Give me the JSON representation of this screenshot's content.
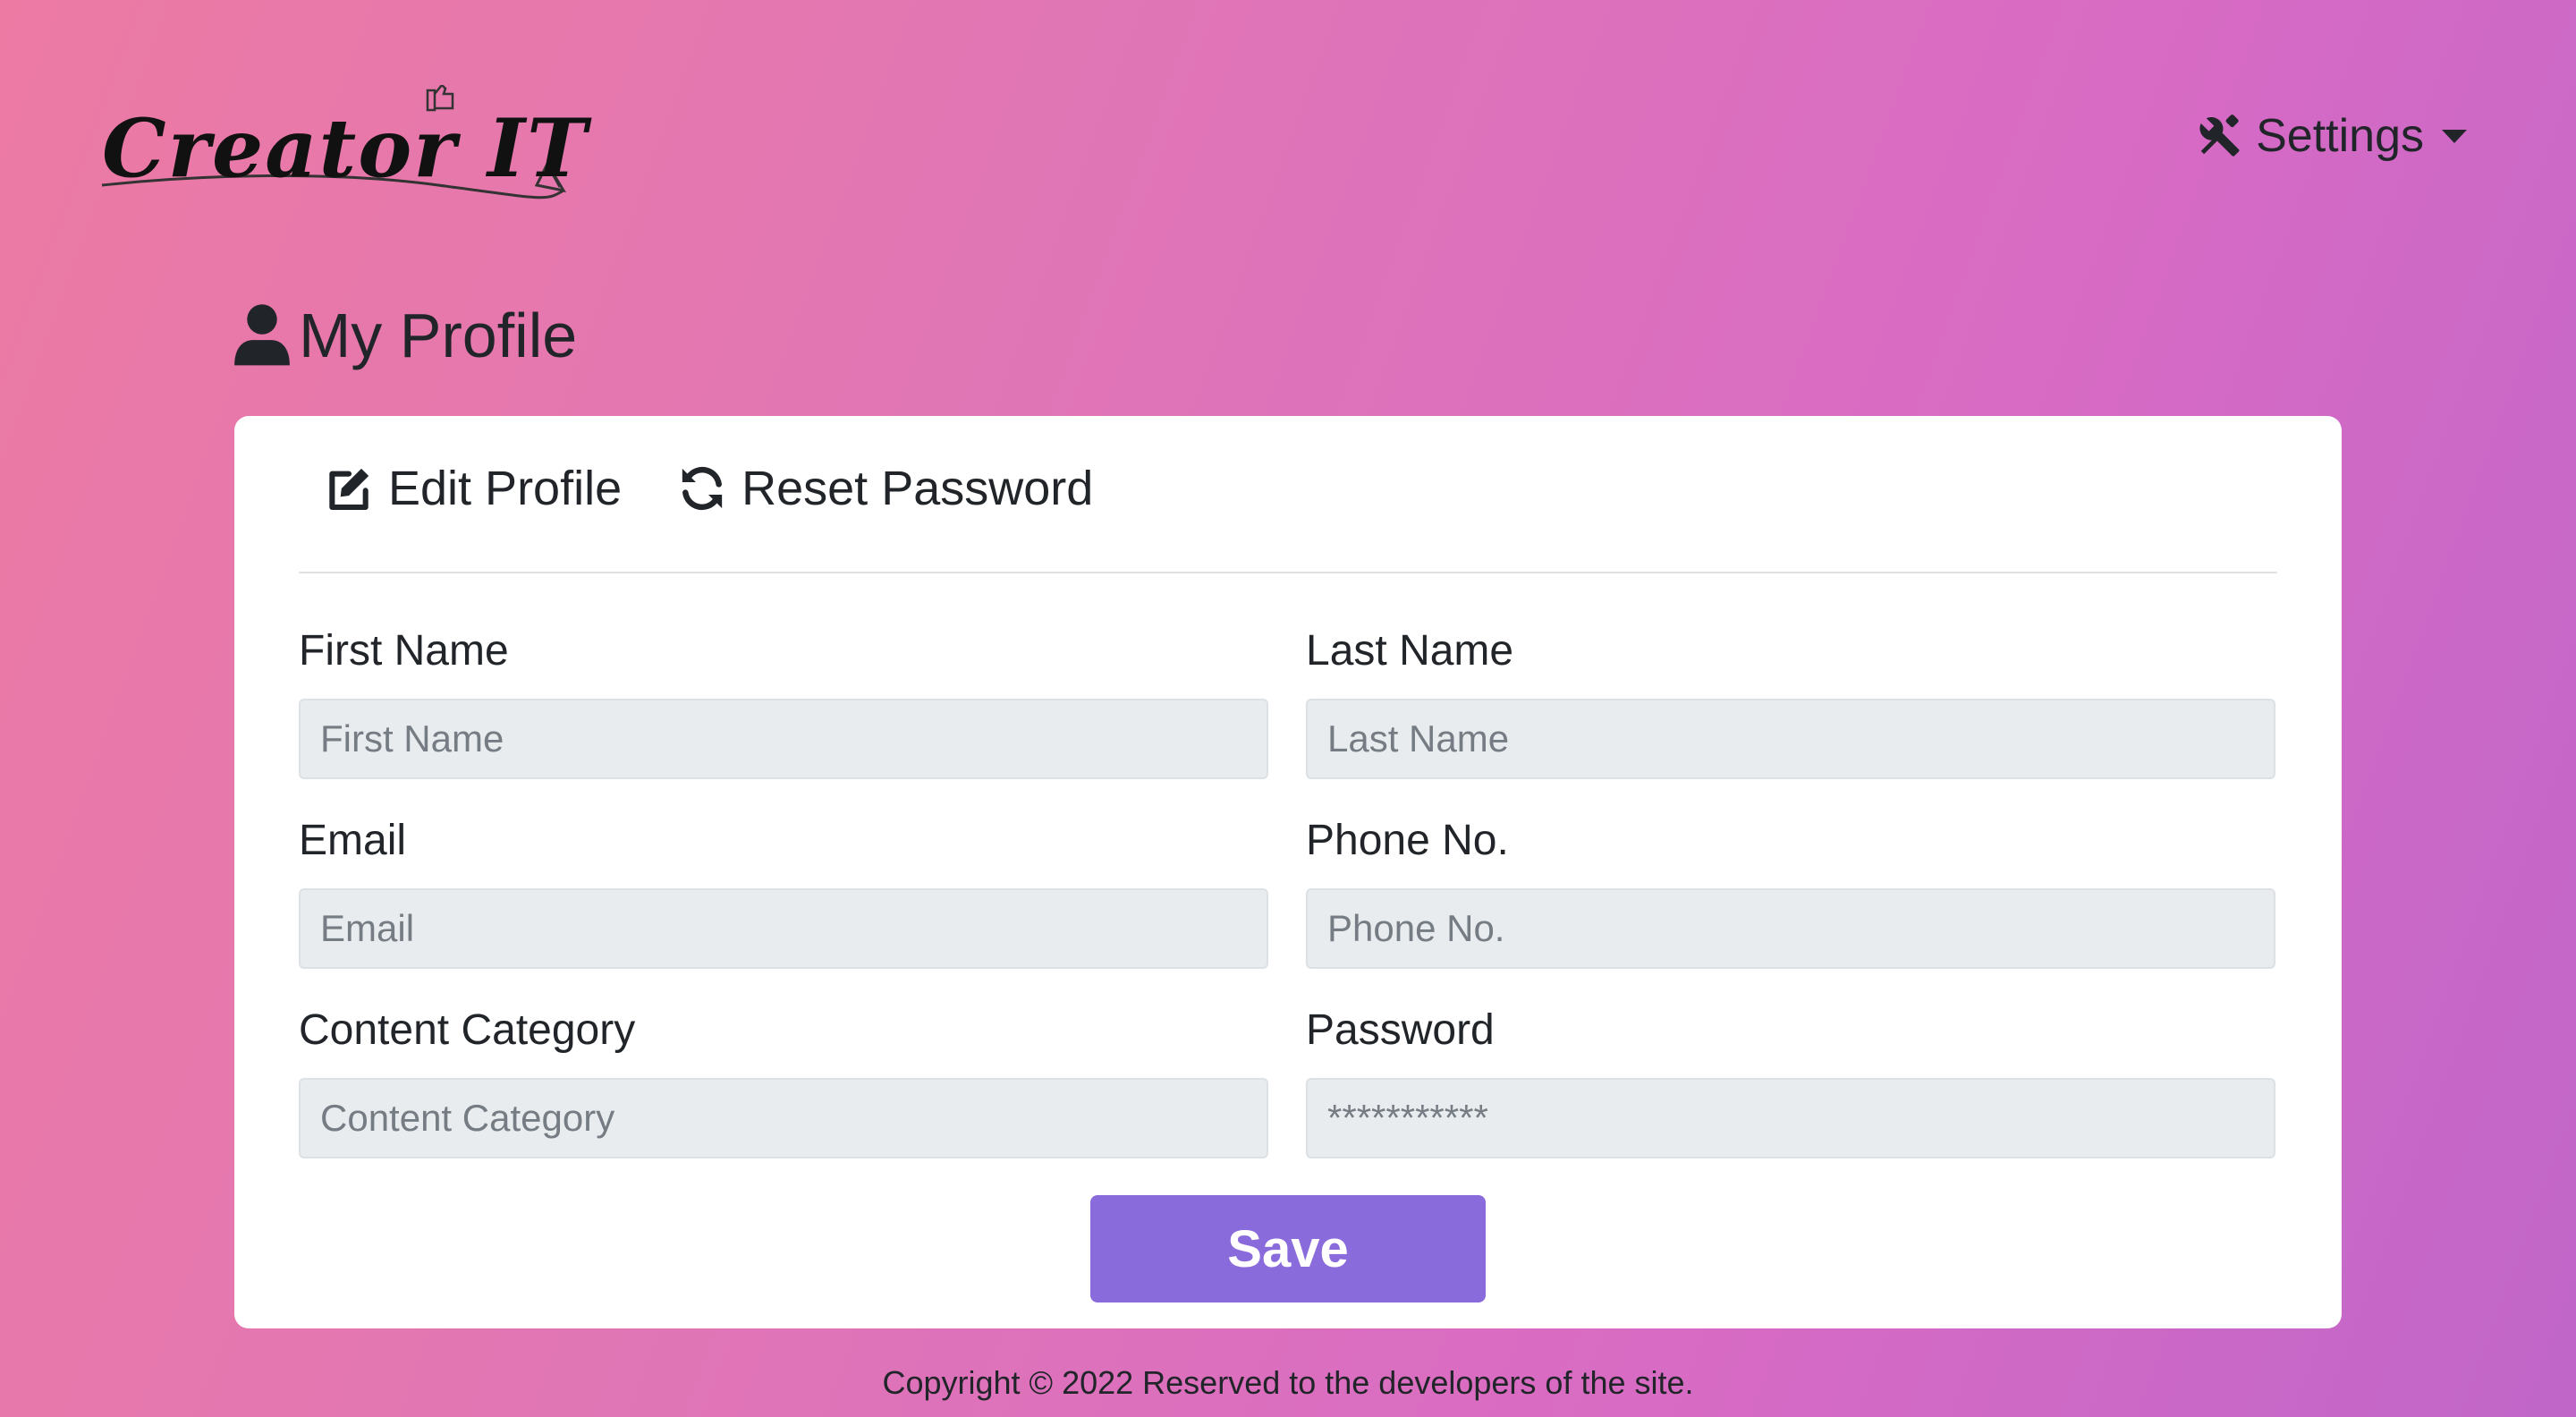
{
  "header": {
    "logo_text": "Creator IT",
    "settings_label": "Settings"
  },
  "page": {
    "title": "My Profile"
  },
  "tabs": [
    {
      "label": "Edit Profile",
      "icon": "edit-icon"
    },
    {
      "label": "Reset Password",
      "icon": "refresh-icon"
    }
  ],
  "form": {
    "first_name": {
      "label": "First Name",
      "placeholder": "First Name"
    },
    "last_name": {
      "label": "Last Name",
      "placeholder": "Last Name"
    },
    "email": {
      "label": "Email",
      "placeholder": "Email"
    },
    "phone": {
      "label": "Phone No.",
      "placeholder": "Phone No."
    },
    "content_category": {
      "label": "Content Category",
      "placeholder": "Content Category"
    },
    "password": {
      "label": "Password",
      "placeholder": "***********"
    },
    "save_label": "Save"
  },
  "footer": {
    "copyright": "Copyright © 2022 Reserved to the developers of the site."
  },
  "colors": {
    "accent": "#8a6bdb",
    "input_bg": "#e9ecef"
  }
}
